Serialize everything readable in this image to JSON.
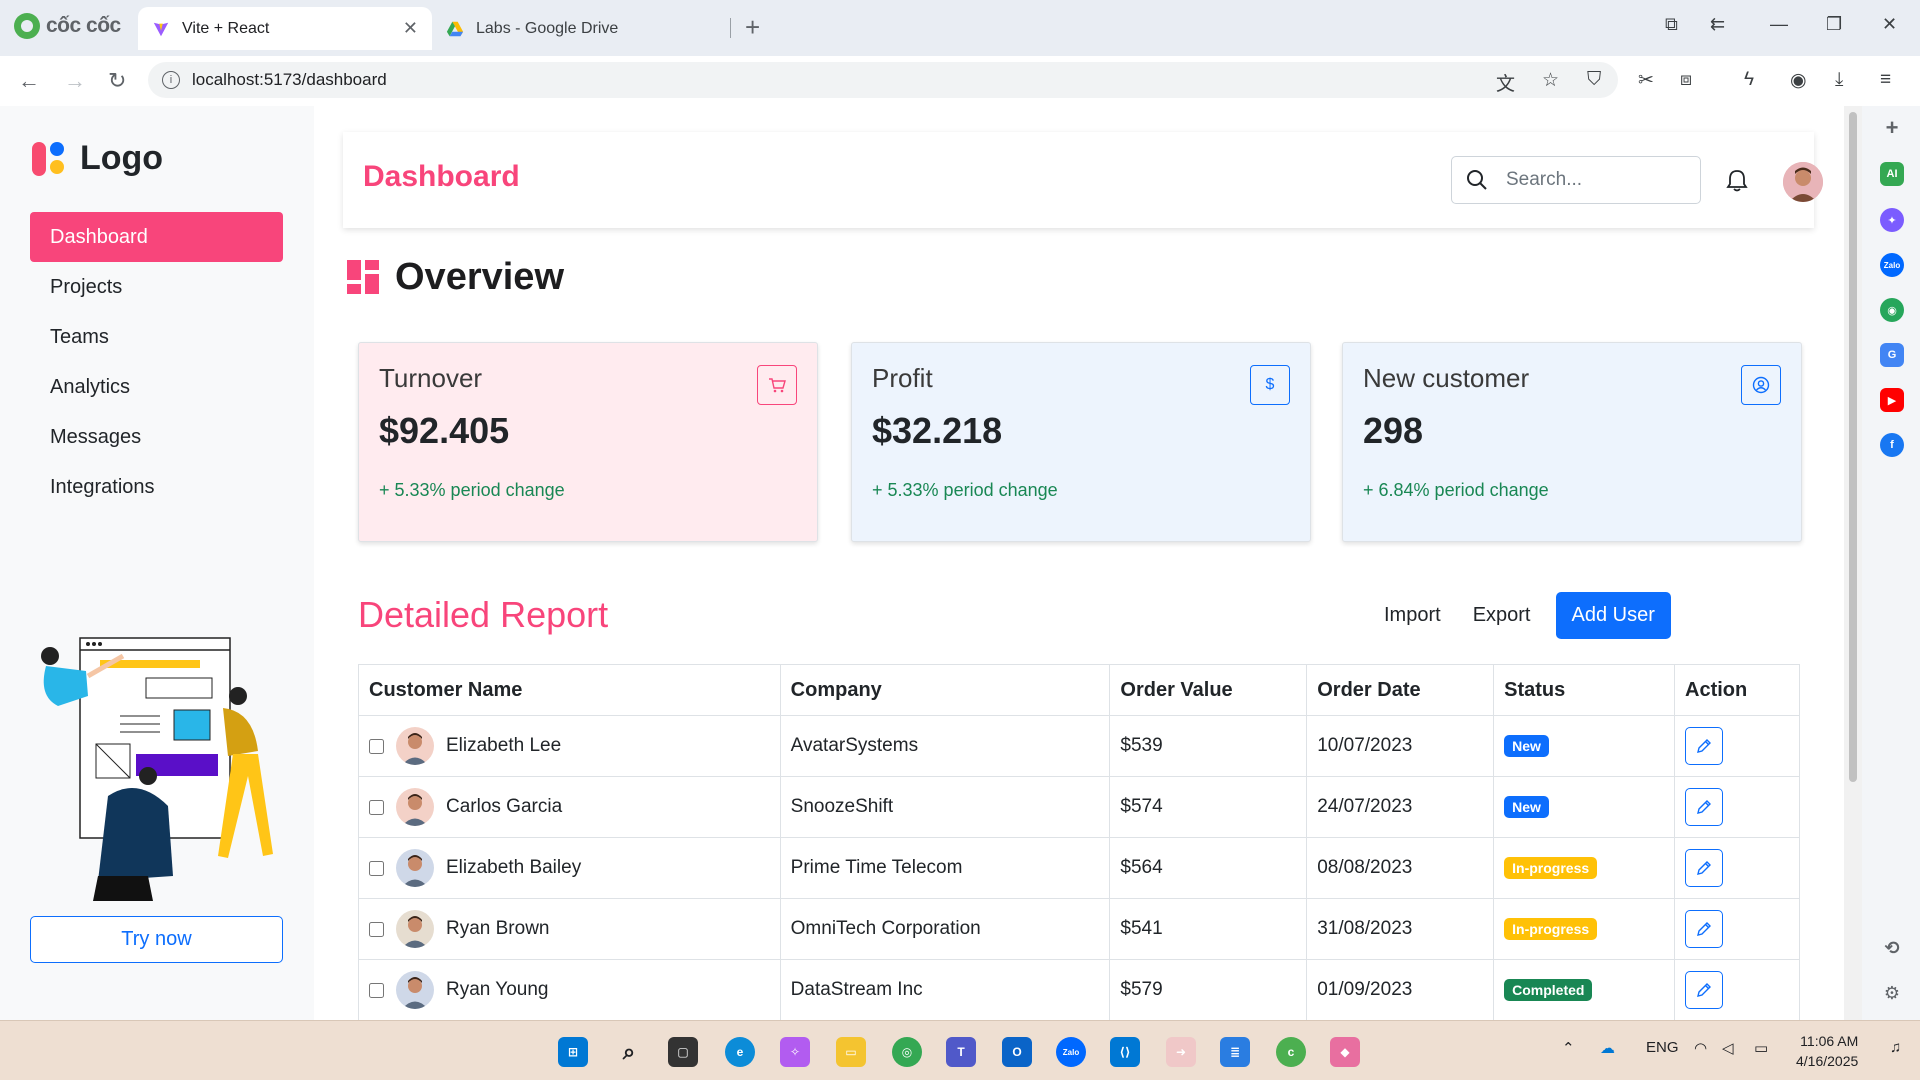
{
  "browser": {
    "brand": "cốc cốc",
    "tabs": [
      {
        "title": "Vite + React",
        "active": true
      },
      {
        "title": "Labs - Google Drive",
        "active": false
      }
    ],
    "url": "localhost:5173/dashboard"
  },
  "app": {
    "logo_text": "Logo",
    "nav": [
      "Dashboard",
      "Projects",
      "Teams",
      "Analytics",
      "Messages",
      "Integrations"
    ],
    "active_nav": "Dashboard",
    "try_now": "Try now",
    "page_title": "Dashboard",
    "search_placeholder": "Search...",
    "overview_title": "Overview",
    "cards": [
      {
        "title": "Turnover",
        "value": "$92.405",
        "change": "+ 5.33% period change",
        "icon": "cart-icon",
        "bg": "#ffebef",
        "accent": "#f8457b"
      },
      {
        "title": "Profit",
        "value": "$32.218",
        "change": "+ 5.33% period change",
        "icon": "dollar-icon",
        "bg": "#edf4fd",
        "accent": "#0d6efd"
      },
      {
        "title": "New customer",
        "value": "298",
        "change": "+ 6.84% period change",
        "icon": "user-circle-icon",
        "bg": "#edf4fd",
        "accent": "#0d6efd"
      }
    ],
    "report_title": "Detailed Report",
    "import_label": "Import",
    "export_label": "Export",
    "add_user_label": "Add User",
    "columns": [
      "Customer Name",
      "Company",
      "Order Value",
      "Order Date",
      "Status",
      "Action"
    ],
    "rows": [
      {
        "name": "Elizabeth Lee",
        "company": "AvatarSystems",
        "value": "$539",
        "date": "10/07/2023",
        "status": "New"
      },
      {
        "name": "Carlos Garcia",
        "company": "SnoozeShift",
        "value": "$574",
        "date": "24/07/2023",
        "status": "New"
      },
      {
        "name": "Elizabeth Bailey",
        "company": "Prime Time Telecom",
        "value": "$564",
        "date": "08/08/2023",
        "status": "In-progress"
      },
      {
        "name": "Ryan Brown",
        "company": "OmniTech Corporation",
        "value": "$541",
        "date": "31/08/2023",
        "status": "In-progress"
      },
      {
        "name": "Ryan Young",
        "company": "DataStream Inc",
        "value": "$579",
        "date": "01/09/2023",
        "status": "Completed"
      }
    ],
    "status_colors": {
      "New": "#0d6efd",
      "In-progress": "#ffc107",
      "Completed": "#198754"
    },
    "accent": "#f8457b",
    "primary": "#0d6efd"
  },
  "taskbar": {
    "language": "ENG",
    "time": "11:06 AM",
    "date": "4/16/2025"
  }
}
